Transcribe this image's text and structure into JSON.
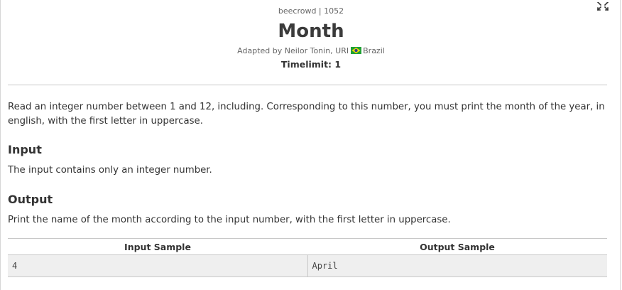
{
  "header": {
    "source": "beecrowd | 1052",
    "title": "Month",
    "adapted_by": "Adapted by Neilor Tonin, URI",
    "country": "Brazil",
    "timelimit": "Timelimit: 1"
  },
  "flag_icon": "brazil-flag-icon",
  "fullscreen_icon": "expand-icon",
  "description": "Read an integer number between 1 and 12, including. Corresponding to this number, you must print the month of the year, in english, with the first letter in uppercase.",
  "input": {
    "heading": "Input",
    "text": "The input contains only an integer number."
  },
  "output": {
    "heading": "Output",
    "text": "Print the name of the month according to the input number, with the first letter in uppercase."
  },
  "samples": {
    "input_header": "Input Sample",
    "output_header": "Output Sample",
    "rows": [
      {
        "input": "4",
        "output": "April"
      }
    ]
  }
}
